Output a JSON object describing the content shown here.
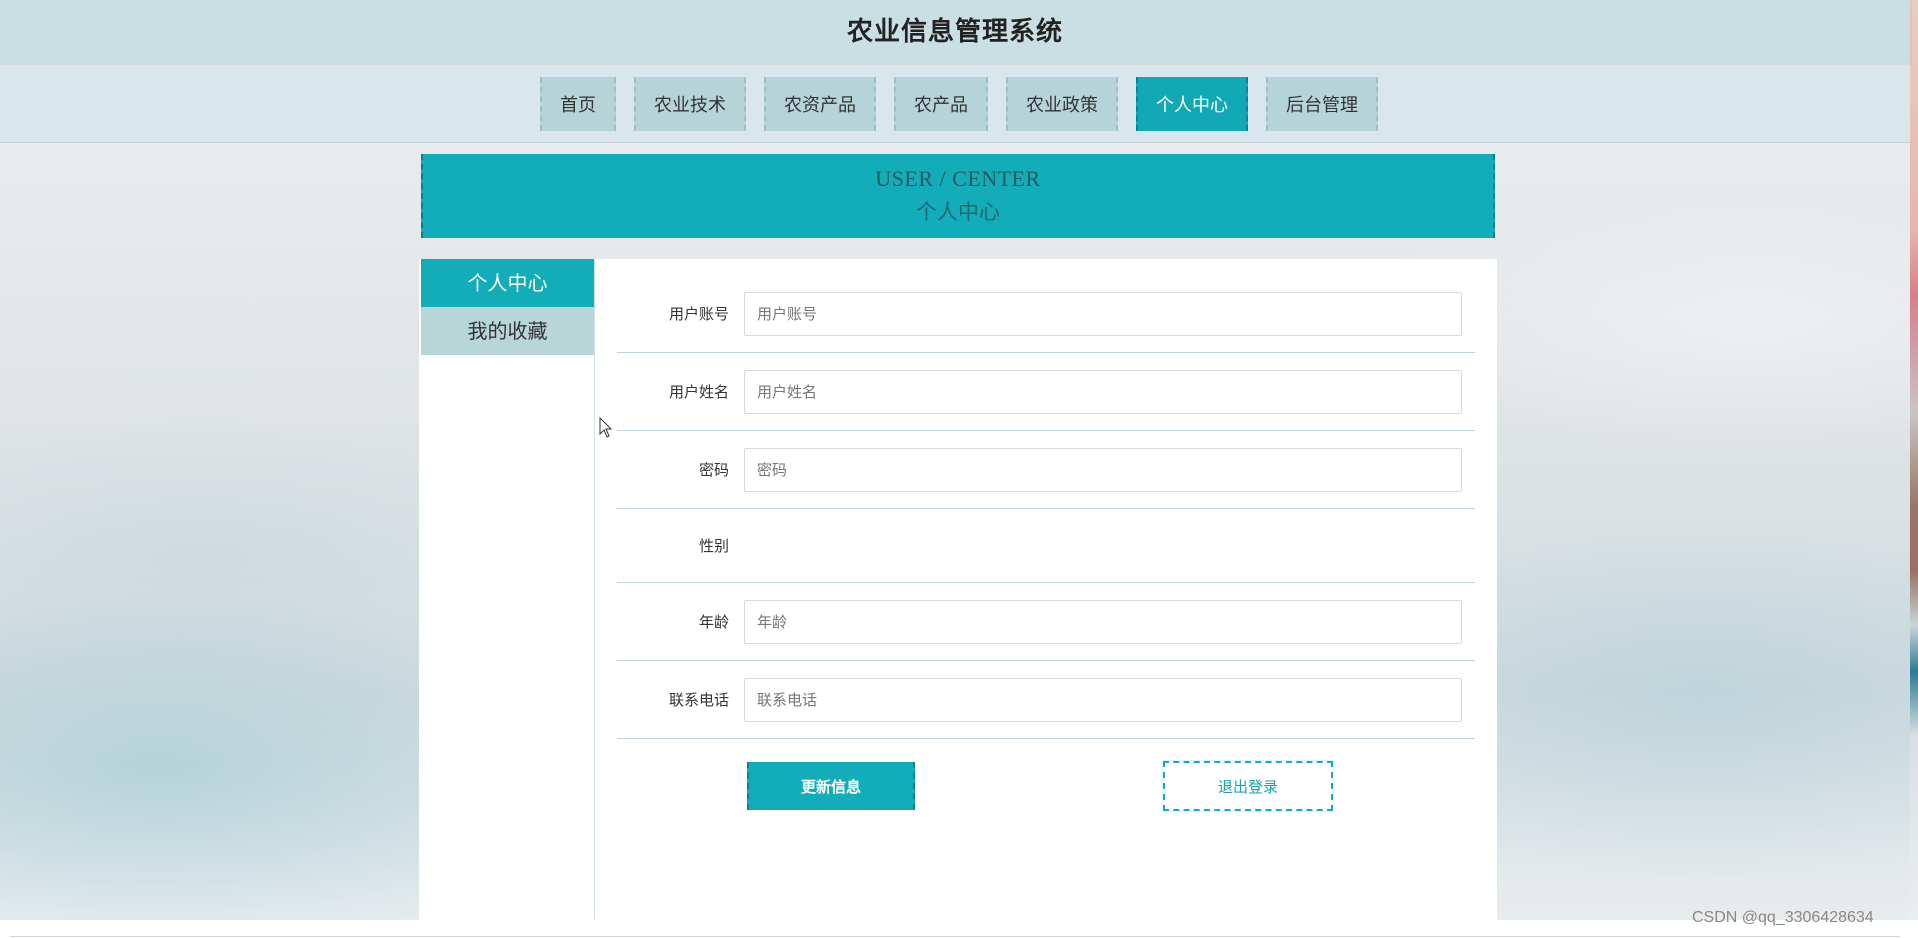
{
  "site": {
    "title": "农业信息管理系统"
  },
  "nav": {
    "items": [
      {
        "label": "首页"
      },
      {
        "label": "农业技术"
      },
      {
        "label": "农资产品"
      },
      {
        "label": "农产品"
      },
      {
        "label": "农业政策"
      },
      {
        "label": "个人中心",
        "active": true
      },
      {
        "label": "后台管理"
      }
    ]
  },
  "banner": {
    "en": "USER / CENTER",
    "cn": "个人中心"
  },
  "sidebar": {
    "items": [
      {
        "label": "个人中心",
        "active": true
      },
      {
        "label": "我的收藏"
      }
    ]
  },
  "form": {
    "account": {
      "label": "用户账号",
      "placeholder": "用户账号",
      "value": ""
    },
    "name": {
      "label": "用户姓名",
      "placeholder": "用户姓名",
      "value": ""
    },
    "password": {
      "label": "密码",
      "placeholder": "密码",
      "value": ""
    },
    "gender": {
      "label": "性别"
    },
    "age": {
      "label": "年龄",
      "placeholder": "年龄",
      "value": ""
    },
    "phone": {
      "label": "联系电话",
      "placeholder": "联系电话",
      "value": ""
    }
  },
  "buttons": {
    "update": "更新信息",
    "logout": "退出登录"
  },
  "watermark": "CSDN @qq_3306428634",
  "colors": {
    "accent": "#13acb9",
    "header_bg": "#c9dfe3",
    "nav_item": "#b6d4d8"
  }
}
